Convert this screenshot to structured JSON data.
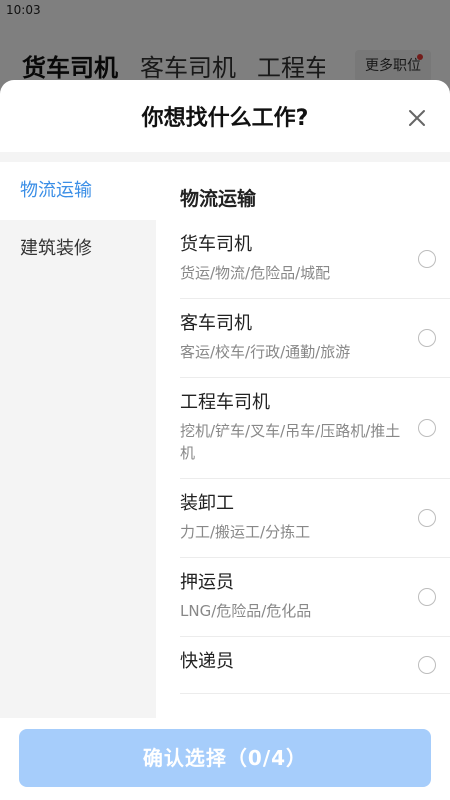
{
  "status_bar": {
    "time": "10:03"
  },
  "background_tabs": {
    "items": [
      {
        "label": "货车司机",
        "active": true
      },
      {
        "label": "客车司机",
        "active": false
      },
      {
        "label": "工程车",
        "active": false
      }
    ],
    "more_jobs_label": "更多职位"
  },
  "sheet": {
    "title": "你想找什么工作?",
    "close_icon": "close-icon",
    "categories": [
      {
        "label": "物流运输",
        "active": true
      },
      {
        "label": "建筑装修",
        "active": false
      }
    ],
    "current_category_title": "物流运输",
    "jobs": [
      {
        "title": "货车司机",
        "desc": "货运/物流/危险品/城配",
        "selected": false
      },
      {
        "title": "客车司机",
        "desc": "客运/校车/行政/通勤/旅游",
        "selected": false
      },
      {
        "title": "工程车司机",
        "desc": "挖机/铲车/叉车/吊车/压路机/推土机",
        "selected": false
      },
      {
        "title": "装卸工",
        "desc": "力工/搬运工/分拣工",
        "selected": false
      },
      {
        "title": "押运员",
        "desc": "LNG/危险品/危化品",
        "selected": false
      },
      {
        "title": "快递员",
        "desc": "",
        "selected": false
      }
    ],
    "confirm_label": "确认选择（0/4）"
  },
  "colors": {
    "accent": "#3a8ee6",
    "confirm_button_bg": "#a6cdfb",
    "sidebar_bg": "#f4f4f4"
  }
}
